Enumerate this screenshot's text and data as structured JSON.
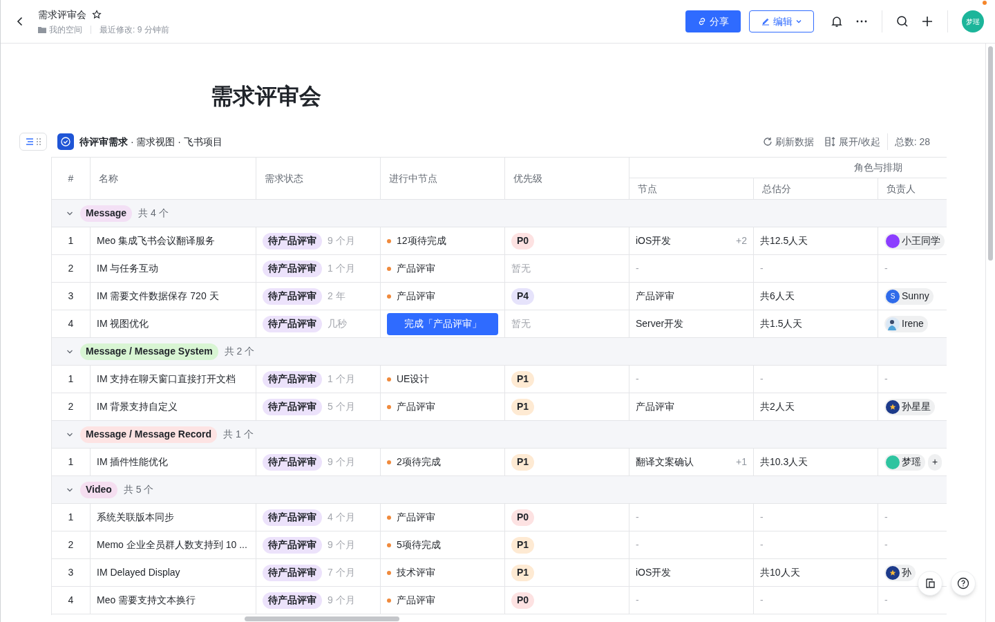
{
  "header": {
    "title": "需求评审会",
    "location": "我的空间",
    "modified": "最近修改: 9 分钟前",
    "share": "分享",
    "edit": "编辑",
    "avatar": "梦瑶",
    "notification_dot": true
  },
  "doc": {
    "title": "需求评审会"
  },
  "view": {
    "title": "待评审需求",
    "path": " · 需求视图 · 飞书项目",
    "refresh": "刷新数据",
    "toggle": "展开/收起",
    "total": "总数: 28"
  },
  "table": {
    "columns": [
      "#",
      "名称",
      "需求状态",
      "进行中节点",
      "优先级"
    ],
    "group_column": "角色与排期",
    "sub_columns": [
      "节点",
      "总估分",
      "负责人"
    ],
    "groups": [
      {
        "name": "Message",
        "color": "#f3e0f5",
        "count": "共 4 个",
        "expanded": true,
        "rows": [
          {
            "index": "1",
            "name": "Meo 集成飞书会议翻译服务",
            "status": "待产品评审",
            "age": "9 个月",
            "stage": {
              "kind": "dot",
              "text": "12项待完成"
            },
            "priority": {
              "kind": "tag",
              "text": "P0",
              "color": "#fde2e2"
            },
            "node": "iOS开发",
            "node_extra": "+2",
            "estimate": "共12.5人天",
            "owner": {
              "kind": "person",
              "name": "小王同学",
              "avatar": {
                "kind": "plain",
                "color": "#8b3dff"
              }
            }
          },
          {
            "index": "2",
            "name": "IM 与任务互动",
            "status": "待产品评审",
            "age": "1 个月",
            "stage": {
              "kind": "dot",
              "text": "产品评审"
            },
            "priority": {
              "kind": "none",
              "text": "暂无"
            },
            "node": "-",
            "estimate": "-",
            "owner": {
              "kind": "none",
              "name": "-"
            }
          },
          {
            "index": "3",
            "name": "IM 需要文件数据保存 720 天",
            "status": "待产品评审",
            "age": "2 年",
            "stage": {
              "kind": "dot",
              "text": "产品评审"
            },
            "priority": {
              "kind": "tag",
              "text": "P4",
              "color": "#e6e3fb"
            },
            "node": "产品评审",
            "estimate": "共6人天",
            "owner": {
              "kind": "person",
              "name": "Sunny",
              "avatar": {
                "kind": "letter",
                "letter": "S",
                "color": "#2f6bea"
              }
            }
          },
          {
            "index": "4",
            "name": "IM 视图优化",
            "status": "待产品评审",
            "age": "几秒",
            "stage": {
              "kind": "action",
              "text": "完成「产品评审」"
            },
            "priority": {
              "kind": "none",
              "text": "暂无"
            },
            "node": "Server开发",
            "estimate": "共1.5人天",
            "owner": {
              "kind": "person",
              "name": "Irene"
            }
          }
        ]
      },
      {
        "name": "Message / Message System",
        "color": "#d8f5d3",
        "count": "共 2 个",
        "expanded": true,
        "rows": [
          {
            "index": "1",
            "name": "IM 支持在聊天窗口直接打开文档",
            "status": "待产品评审",
            "age": "1 个月",
            "stage": {
              "kind": "dot",
              "text": "UE设计"
            },
            "priority": {
              "kind": "tag",
              "text": "P1",
              "color": "#feead3"
            },
            "node": "-",
            "estimate": "-",
            "owner": {
              "kind": "none",
              "name": "-"
            }
          },
          {
            "index": "2",
            "name": "IM 背景支持自定义",
            "status": "待产品评审",
            "age": "5 个月",
            "stage": {
              "kind": "dot",
              "text": "产品评审"
            },
            "priority": {
              "kind": "tag",
              "text": "P1",
              "color": "#feead3"
            },
            "node": "产品评审",
            "estimate": "共2人天",
            "owner": {
              "kind": "person",
              "name": "孙星星",
              "avatar": {
                "kind": "star",
                "color": "#1c3a8a"
              }
            }
          }
        ]
      },
      {
        "name": "Message / Message Record",
        "color": "#fde3e3",
        "count": "共 1 个",
        "expanded": true,
        "rows": [
          {
            "index": "1",
            "name": "IM 插件性能优化",
            "status": "待产品评审",
            "age": "9 个月",
            "stage": {
              "kind": "dot",
              "text": "2项待完成"
            },
            "priority": {
              "kind": "tag",
              "text": "P1",
              "color": "#feead3"
            },
            "node": "翻译文案确认",
            "node_extra": "+1",
            "estimate": "共10.3人天",
            "owner": {
              "kind": "person",
              "name": "梦瑶",
              "avatar": {
                "kind": "plain",
                "color": "#2ec4a0"
              },
              "more": "+"
            }
          }
        ]
      },
      {
        "name": "Video",
        "color": "#f5def0",
        "count": "共 5 个",
        "expanded": true,
        "rows": [
          {
            "index": "1",
            "name": "系统关联版本同步",
            "status": "待产品评审",
            "age": "4 个月",
            "stage": {
              "kind": "dot",
              "text": "产品评审"
            },
            "priority": {
              "kind": "tag",
              "text": "P0",
              "color": "#fde2e2"
            },
            "node": "-",
            "estimate": "-",
            "owner": {
              "kind": "none",
              "name": "-"
            }
          },
          {
            "index": "2",
            "name": "Memo 企业全员群人数支持到 10 ...",
            "status": "待产品评审",
            "age": "9 个月",
            "stage": {
              "kind": "dot",
              "text": "5项待完成"
            },
            "priority": {
              "kind": "tag",
              "text": "P1",
              "color": "#feead3"
            },
            "node": "-",
            "estimate": "-",
            "owner": {
              "kind": "none",
              "name": "-"
            }
          },
          {
            "index": "3",
            "name": "IM Delayed Display",
            "status": "待产品评审",
            "age": "7 个月",
            "stage": {
              "kind": "dot",
              "text": "技术评审"
            },
            "priority": {
              "kind": "tag",
              "text": "P1",
              "color": "#feead3"
            },
            "node": "iOS开发",
            "estimate": "共10人天",
            "owner": {
              "kind": "person",
              "name": "孙",
              "avatar": {
                "kind": "star",
                "color": "#1c3a8a"
              }
            }
          },
          {
            "index": "4",
            "name": "Meo 需要支持文本换行",
            "status": "待产品评审",
            "age": "9 个月",
            "stage": {
              "kind": "dot",
              "text": "产品评审"
            },
            "priority": {
              "kind": "tag",
              "text": "P0",
              "color": "#fde2e2"
            },
            "node": "-",
            "estimate": "-",
            "owner": {
              "kind": "none",
              "name": "-"
            }
          }
        ]
      }
    ]
  }
}
